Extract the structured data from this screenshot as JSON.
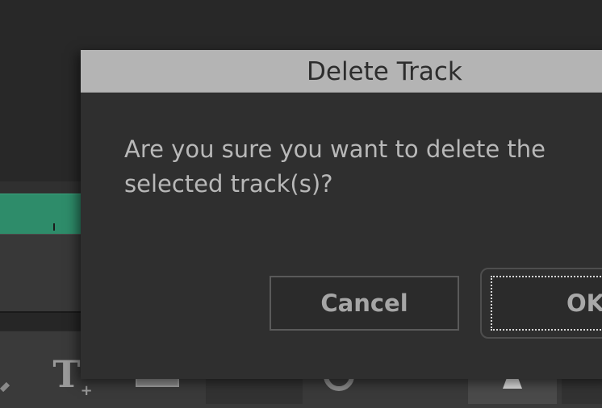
{
  "dialog": {
    "title": "Delete Track",
    "message": "Are you sure you want to delete the selected track(s)?",
    "cancel_label": "Cancel",
    "ok_label": "OK"
  },
  "toolbar": {
    "icons": [
      "edit-icon",
      "add-text-icon",
      "image-icon",
      "ruler-icon",
      "speed-icon",
      "minus-icon",
      "marker-icon"
    ]
  },
  "colors": {
    "accent_track": "#2e8c6a",
    "title_bar": "#b4b4b4",
    "dialog_bg": "#2f2f2f"
  }
}
